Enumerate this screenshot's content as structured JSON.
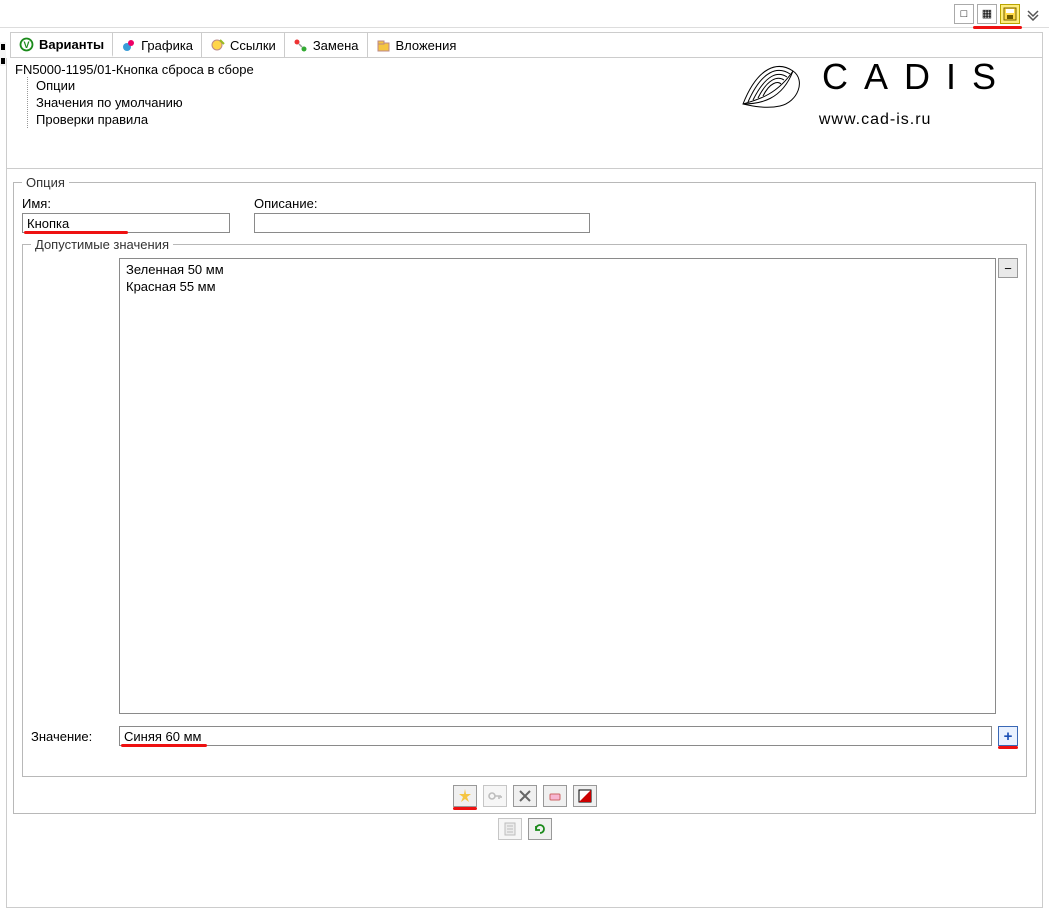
{
  "titleBar": {
    "windowIconTitle": "□",
    "calendarIconTitle": "▦",
    "saveIconTitle": "💾",
    "collapseIconTitle": "⌄"
  },
  "tabs": {
    "variants": "Варианты",
    "graphics": "Графика",
    "links": "Ссылки",
    "replace": "Замена",
    "attachments": "Вложения"
  },
  "tree": {
    "root": "FN5000-1195/01-Кнопка сброса в сборе",
    "options": "Опции",
    "defaults": "Значения по умолчанию",
    "rules": "Проверки правила"
  },
  "watermark": {
    "brand": "CADIS",
    "url": "www.cad-is.ru"
  },
  "option": {
    "legend": "Опция",
    "nameLabel": "Имя:",
    "nameValue": "Кнопка",
    "descLabel": "Описание:",
    "descValue": ""
  },
  "allowed": {
    "legend": "Допустимые значения",
    "items": [
      "Зеленная 50 мм",
      "Красная 55 мм"
    ],
    "removeBtn": "−",
    "valueLabel": "Значение:",
    "valueValue": "Синяя 60 мм",
    "addBtn": "+"
  },
  "bottomToolbar": {
    "new": "✨",
    "key": "🔑",
    "delete": "✕",
    "eraser": "▱",
    "flag": "◩"
  },
  "footerToolbar": {
    "doc": "▤",
    "refresh": "↻"
  }
}
